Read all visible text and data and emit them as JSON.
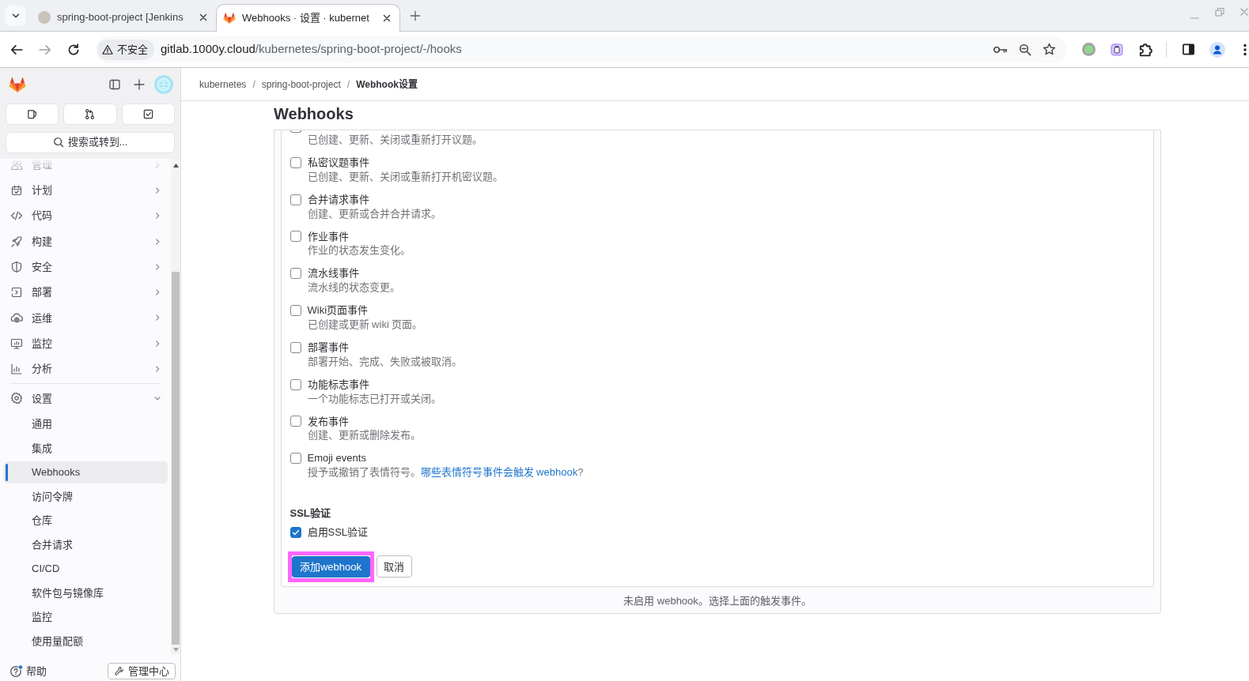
{
  "browser": {
    "tabs": [
      {
        "kind": "avatar",
        "title": "spring-boot-project [Jenkins",
        "selected": false
      },
      {
        "kind": "gitlab",
        "title": "Webhooks · 设置 · kubernet",
        "selected": true
      }
    ],
    "security_chip": "不安全",
    "url": {
      "host": "gitlab.1000y.cloud",
      "path": "/kubernetes/spring-boot-project/-/hooks"
    }
  },
  "sidebar": {
    "search": {
      "label": "搜索或转到..."
    },
    "nav": [
      {
        "label": "管理",
        "expanded": false
      },
      {
        "label": "计划",
        "expanded": false
      },
      {
        "label": "代码",
        "expanded": false
      },
      {
        "label": "构建",
        "expanded": false
      },
      {
        "label": "安全",
        "expanded": false
      },
      {
        "label": "部署",
        "expanded": false
      },
      {
        "label": "运维",
        "expanded": false
      },
      {
        "label": "监控",
        "expanded": false
      },
      {
        "label": "分析",
        "expanded": false
      },
      {
        "label": "设置",
        "expanded": true,
        "children": [
          {
            "label": "通用",
            "selected": false
          },
          {
            "label": "集成",
            "selected": false
          },
          {
            "label": "Webhooks",
            "selected": true
          },
          {
            "label": "访问令牌",
            "selected": false
          },
          {
            "label": "仓库",
            "selected": false
          },
          {
            "label": "合并请求",
            "selected": false
          },
          {
            "label": "CI/CD",
            "selected": false
          },
          {
            "label": "软件包与镜像库",
            "selected": false
          },
          {
            "label": "监控",
            "selected": false
          },
          {
            "label": "使用量配额",
            "selected": false
          }
        ]
      }
    ],
    "help": "帮助",
    "admin_button": "管理中心"
  },
  "breadcrumbs": {
    "separator": "/",
    "items": [
      {
        "label": "kubernetes",
        "current": false
      },
      {
        "label": "spring-boot-project",
        "current": false
      },
      {
        "label": "Webhook设置",
        "current": true
      }
    ]
  },
  "page_title": "Webhooks",
  "events": [
    {
      "description": "已创建、更新、关闭或重新打开议题。",
      "checked": false
    },
    {
      "label": "私密议题事件",
      "description": "已创建、更新、关闭或重新打开机密议题。",
      "checked": false
    },
    {
      "label": "合并请求事件",
      "description": "创建、更新或合并合并请求。",
      "checked": false
    },
    {
      "label": "作业事件",
      "description": "作业的状态发生变化。",
      "checked": false
    },
    {
      "label": "流水线事件",
      "description": "流水线的状态变更。",
      "checked": false
    },
    {
      "label": "Wiki页面事件",
      "description": "已创建或更新 wiki 页面。",
      "checked": false
    },
    {
      "label": "部署事件",
      "description": "部署开始、完成、失败或被取消。",
      "checked": false
    },
    {
      "label": "功能标志事件",
      "description": "一个功能标志已打开或关闭。",
      "checked": false
    },
    {
      "label": "发布事件",
      "description": "创建、更新或删除发布。",
      "checked": false
    },
    {
      "label": "Emoji events",
      "description": "授予或撤销了表情符号。",
      "link": "哪些表情符号事件会触发 webhook",
      "after_link": "?",
      "checked": false
    }
  ],
  "ssl": {
    "heading": "SSL验证",
    "label": "启用SSL验证",
    "checked": true
  },
  "actions": [
    {
      "kind": "primary",
      "label": "添加webhook",
      "highlighted": true
    },
    {
      "kind": "secondary",
      "label": "取消",
      "highlighted": false
    }
  ],
  "footer_note": "未启用 webhook。选择上面的触发事件。"
}
